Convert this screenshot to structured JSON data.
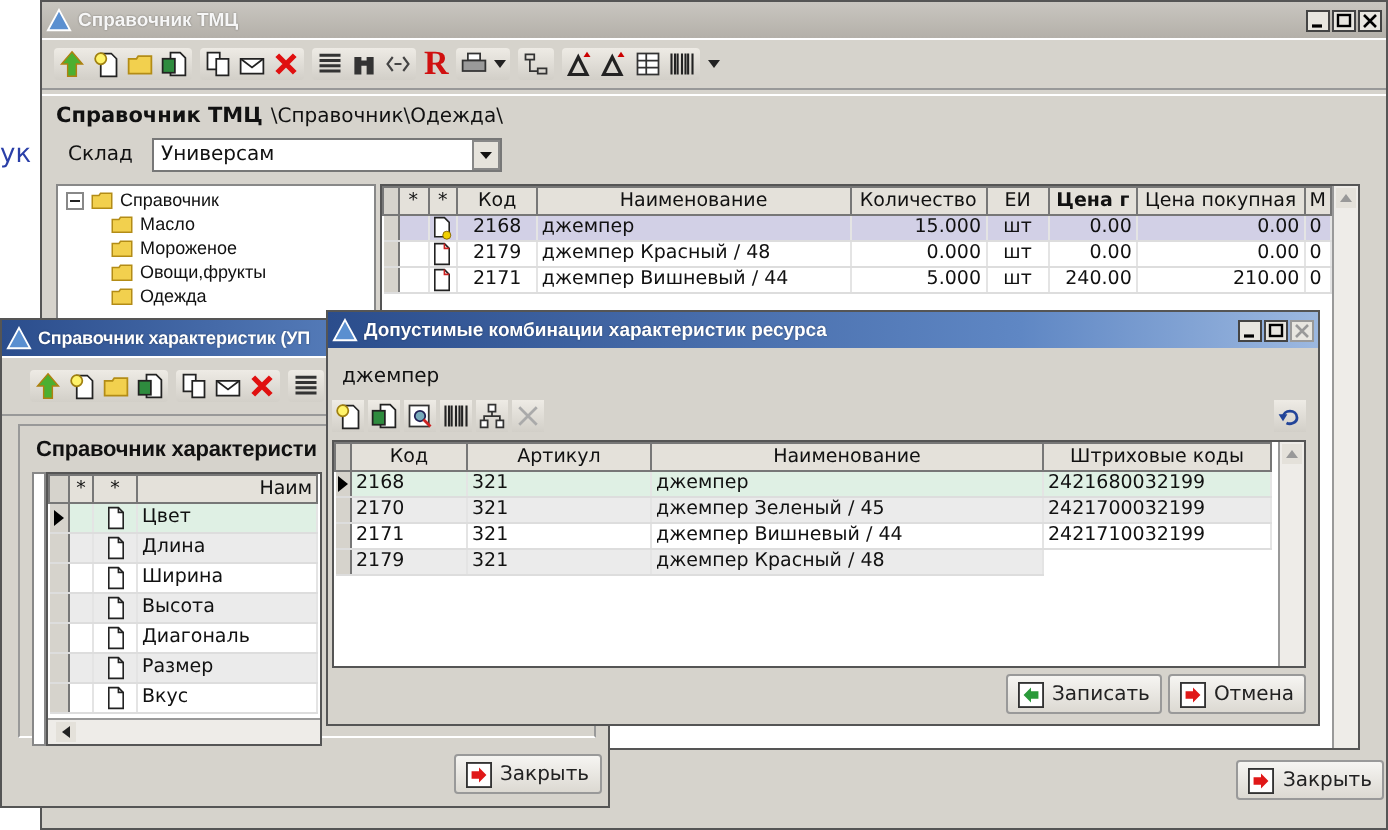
{
  "desktop": {
    "text": "ук"
  },
  "main_window": {
    "title": "Справочник ТМЦ",
    "active": false,
    "toolbar_letter": "R",
    "heading": "Справочник ТМЦ",
    "path": "\\Справочник\\Одежда\\",
    "warehouse": {
      "label": "Склад",
      "value": "Универсам"
    },
    "tree": {
      "label": "Справочник",
      "expanded": true,
      "children": [
        {
          "label": "Масло"
        },
        {
          "label": "Мороженое"
        },
        {
          "label": "Овощи,фрукты"
        },
        {
          "label": "Одежда"
        }
      ]
    },
    "table": {
      "marker_columns": [
        "*",
        "*"
      ],
      "columns": [
        "Код",
        "Наименование",
        "Количество",
        "ЕИ",
        "Цена г",
        "Цена покупная",
        "М"
      ],
      "rows": [
        {
          "kind": "new",
          "selected": true,
          "cells": [
            "2168",
            "джемпер",
            "15.000",
            "шт",
            "0.00",
            "0.00",
            "0"
          ]
        },
        {
          "kind": "document",
          "selected": false,
          "cells": [
            "2179",
            "джемпер Красный / 48",
            "0.000",
            "шт",
            "0.00",
            "0.00",
            "0"
          ]
        },
        {
          "kind": "document",
          "selected": false,
          "cells": [
            "2171",
            "джемпер Вишневый / 44",
            "5.000",
            "шт",
            "240.00",
            "210.00",
            "0"
          ]
        }
      ]
    },
    "close_button": "Закрыть"
  },
  "characteristics_window": {
    "title": "Справочник характеристик (УП",
    "active": true,
    "heading": "Справочник характеристи",
    "table": {
      "marker_columns": [
        "*",
        "*"
      ],
      "columns": [
        "Наим"
      ],
      "rows": [
        {
          "name": "Цвет",
          "selected": true
        },
        {
          "name": "Длина",
          "selected": false
        },
        {
          "name": "Ширина",
          "selected": false
        },
        {
          "name": "Высота",
          "selected": false
        },
        {
          "name": "Диагональ",
          "selected": false
        },
        {
          "name": "Размер",
          "selected": false
        },
        {
          "name": "Вкус",
          "selected": false
        }
      ]
    },
    "close_button": "Закрыть"
  },
  "combinations_window": {
    "title": "Допустимые комбинации характеристик ресурса",
    "active": true,
    "resource": "джемпер",
    "table": {
      "columns": [
        "Код",
        "Артикул",
        "Наименование",
        "Штриховые коды"
      ],
      "rows": [
        {
          "selected": true,
          "cells": [
            "2168",
            "321",
            "джемпер",
            "2421680032199"
          ]
        },
        {
          "selected": false,
          "cells": [
            "2170",
            "321",
            "джемпер Зеленый / 45",
            "2421700032199"
          ]
        },
        {
          "selected": false,
          "cells": [
            "2171",
            "321",
            "джемпер Вишневый / 44",
            "2421710032199"
          ]
        },
        {
          "selected": false,
          "cells": [
            "2179",
            "321",
            "джемпер Красный / 48"
          ]
        }
      ]
    },
    "buttons": [
      "Записать",
      "Отмена"
    ]
  }
}
